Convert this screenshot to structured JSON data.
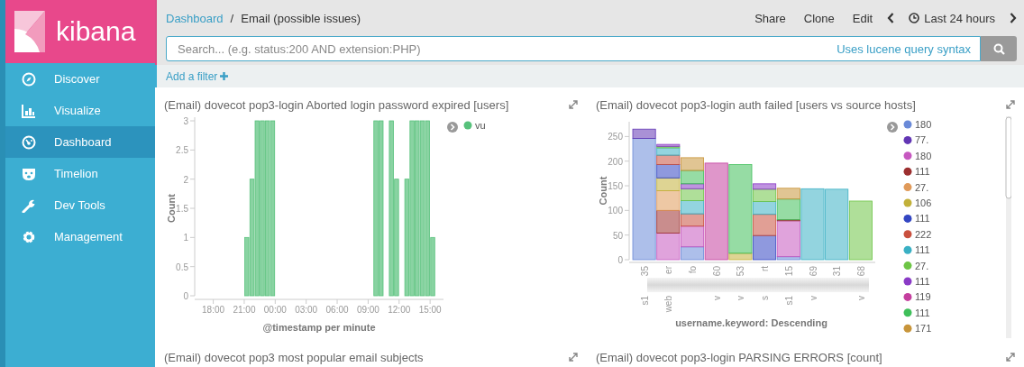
{
  "sidebar": {
    "logo": "kibana",
    "items": [
      {
        "label": "Discover",
        "selected": false
      },
      {
        "label": "Visualize",
        "selected": false
      },
      {
        "label": "Dashboard",
        "selected": true
      },
      {
        "label": "Timelion",
        "selected": false
      },
      {
        "label": "Dev Tools",
        "selected": false
      },
      {
        "label": "Management",
        "selected": false
      }
    ]
  },
  "top_bar": {
    "breadcrumbs": [
      {
        "label": "Dashboard",
        "kind": "link"
      },
      {
        "label": "Email (possible issues)",
        "kind": "current"
      }
    ],
    "separator": "/",
    "actions": [
      "Share",
      "Clone",
      "Edit"
    ],
    "time_range": "Last 24 hours"
  },
  "search": {
    "placeholder": "Search... (e.g. status:200 AND extension:PHP)",
    "syntax_link": "Uses lucene query syntax"
  },
  "filter_bar": {
    "add_filter": "Add a filter"
  },
  "panels": [
    {
      "kind": "histogram",
      "title": "(Email) dovecot pop3-login Aborted login password expired [users]",
      "legend": [
        {
          "label": "vu",
          "color": "#57c17b"
        }
      ],
      "chart_data": {
        "type": "bar",
        "xlabel": "@timestamp per minute",
        "ylabel": "Count",
        "categories": [
          null,
          null,
          null,
          "18:00",
          null,
          null,
          null,
          null,
          null,
          "21:00",
          null,
          null,
          null,
          null,
          null,
          "00:00",
          null,
          null,
          null,
          null,
          null,
          "03:00",
          null,
          null,
          null,
          null,
          null,
          "06:00",
          null,
          null,
          null,
          null,
          null,
          "09:00",
          null,
          null,
          null,
          null,
          null,
          "12:00",
          null,
          null,
          null,
          null,
          null,
          "15:00",
          null
        ],
        "values": [
          0,
          0,
          0,
          0,
          0,
          0,
          0,
          0,
          0,
          1,
          2,
          3,
          3,
          3,
          3,
          0,
          0,
          0,
          0,
          0,
          0,
          0,
          0,
          0,
          0,
          0,
          0,
          0,
          0,
          0,
          0,
          0,
          0,
          0,
          3,
          3,
          0,
          3,
          2,
          0,
          2,
          3,
          3,
          3,
          3,
          1,
          0
        ],
        "ylim": [
          0,
          3
        ],
        "yticks": [
          0,
          0.5,
          1,
          1.5,
          2,
          2.5,
          3
        ]
      }
    },
    {
      "kind": "stacked_bar",
      "title": "(Email) dovecot pop3-login auth failed [users vs source hosts]",
      "category_sublabels": [
        {
          "kind": "label",
          "label": "s1"
        },
        {
          "kind": "label",
          "label": "web"
        },
        {
          "kind": "gap"
        },
        {
          "kind": "label",
          "label": "v"
        },
        {
          "kind": "label",
          "label": "v"
        },
        {
          "kind": "label",
          "label": "s"
        },
        {
          "kind": "label",
          "label": "s1"
        },
        {
          "kind": "label",
          "label": "v"
        },
        {
          "kind": "gap"
        },
        {
          "kind": "label",
          "label": "v"
        }
      ],
      "chart_data": {
        "type": "bar",
        "stacked": true,
        "legend": "right",
        "xlabel": "username.keyword: Descending",
        "ylabel": "Count",
        "categories": [
          "35",
          "er",
          "fo",
          "60",
          "53",
          "rt",
          "15",
          "69",
          "31",
          "68"
        ],
        "ylim": [
          0,
          280
        ],
        "yticks": [
          0,
          50,
          100,
          150,
          200,
          250
        ],
        "series": [
          {
            "name": "180",
            "color": "#6a8ad8",
            "values": [
              246,
              0,
              26,
              0,
              0,
              0,
              6,
              0,
              0,
              0
            ]
          },
          {
            "name": "77.",
            "color": "#6236b4",
            "values": [
              19,
              0,
              0,
              0,
              0,
              0,
              0,
              0,
              0,
              0
            ]
          },
          {
            "name": "180",
            "color": "#c658c0",
            "values": [
              0,
              54,
              42,
              0,
              0,
              0,
              73,
              0,
              0,
              0
            ]
          },
          {
            "name": "111",
            "color": "#9c2f2f",
            "values": [
              0,
              46,
              0,
              0,
              0,
              0,
              2,
              0,
              0,
              0
            ]
          },
          {
            "name": "27.",
            "color": "#e09a5a",
            "values": [
              0,
              40,
              0,
              0,
              0,
              0,
              0,
              0,
              0,
              0
            ]
          },
          {
            "name": "106",
            "color": "#c2b13a",
            "values": [
              0,
              26,
              0,
              0,
              13,
              0,
              0,
              0,
              0,
              0
            ]
          },
          {
            "name": "111",
            "color": "#3346c2",
            "values": [
              0,
              27,
              0,
              0,
              0,
              49,
              0,
              0,
              0,
              0
            ]
          },
          {
            "name": "222",
            "color": "#c9503e",
            "values": [
              0,
              19,
              25,
              0,
              0,
              43,
              0,
              0,
              0,
              0
            ]
          },
          {
            "name": "111",
            "color": "#3ab0c4",
            "values": [
              0,
              15,
              27,
              0,
              0,
              26,
              0,
              144,
              143,
              0
            ]
          },
          {
            "name": "27.",
            "color": "#6dc545",
            "values": [
              0,
              3,
              24,
              0,
              0,
              25,
              0,
              0,
              0,
              119
            ]
          },
          {
            "name": "111",
            "color": "#8a3bc6",
            "values": [
              0,
              4,
              10,
              0,
              0,
              11,
              0,
              0,
              0,
              0
            ]
          },
          {
            "name": "119",
            "color": "#c43f9e",
            "values": [
              0,
              0,
              0,
              196,
              0,
              0,
              0,
              0,
              0,
              0
            ]
          },
          {
            "name": "111",
            "color": "#3fbf5a",
            "values": [
              0,
              0,
              27,
              0,
              180,
              0,
              42,
              0,
              0,
              0
            ]
          },
          {
            "name": "171",
            "color": "#c8953a",
            "values": [
              0,
              0,
              26,
              0,
              0,
              0,
              22,
              0,
              0,
              0
            ]
          }
        ]
      }
    },
    {
      "kind": "empty",
      "title": "(Email) dovecot pop3 most popular email subjects"
    },
    {
      "kind": "empty",
      "title": "(Email) dovecot pop3-login PARSING ERRORS [count]"
    }
  ]
}
